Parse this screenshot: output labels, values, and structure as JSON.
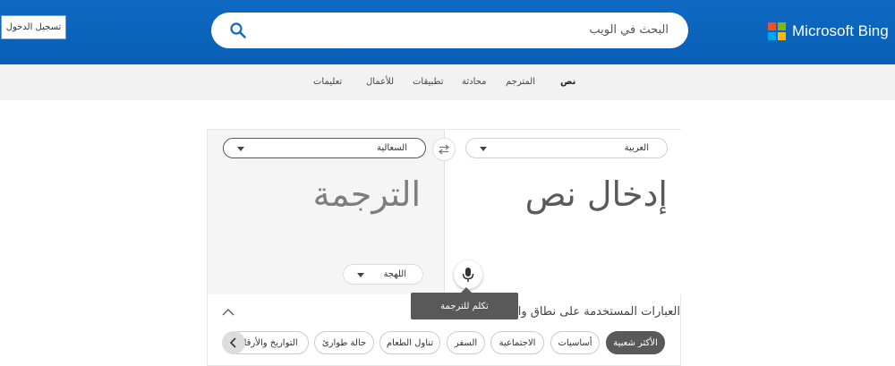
{
  "header": {
    "brand": "Microsoft Bing",
    "search_placeholder": "البحث في الويب",
    "signin_label": "تسجيل الدخول",
    "colors": {
      "header_bg": "#0f69c3",
      "search_icon": "#0f69c3"
    }
  },
  "nav": {
    "items": [
      "نص",
      "المترجم",
      "محادثة",
      "تطبيقات",
      "للأعمال",
      "تعليمات"
    ],
    "active": "نص"
  },
  "translator": {
    "source_language": "العربية",
    "target_language": "السعالية",
    "input_placeholder": "إدخال نص",
    "output_placeholder": "الترجمة",
    "dialect_label": "اللهجة",
    "mic_tooltip": "تكلم للترجمة"
  },
  "phrases": {
    "title": "العبارات المستخدمة على نطاق واسع",
    "chips": [
      "الأكثر شعبية",
      "أساسيات",
      "الاجتماعية",
      "السفر",
      "تناول الطعام",
      "حالة طوارئ",
      "التواريخ والأرقام"
    ],
    "active_chip": "الأكثر شعبية"
  },
  "icons": {
    "search": "search-icon",
    "swap": "swap-icon",
    "mic": "microphone-icon",
    "collapse": "chevron-up-icon",
    "more": "chevron-left-icon"
  }
}
